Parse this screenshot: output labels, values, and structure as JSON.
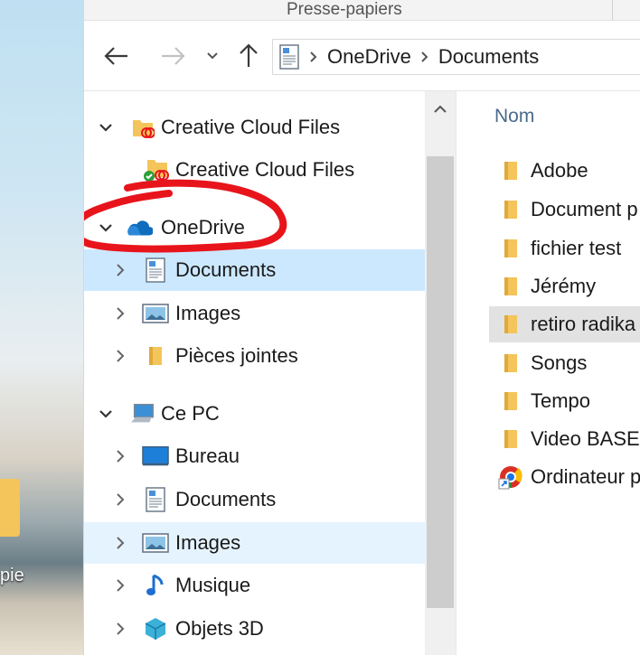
{
  "desktop": {
    "icon_label": "pie"
  },
  "ribbon": {
    "group_label": "Presse-papiers"
  },
  "address": {
    "back_icon": "arrow-left-icon",
    "forward_icon": "arrow-right-icon",
    "recent_icon": "chevron-down-icon",
    "up_icon": "arrow-up-icon",
    "crumbs": [
      "OneDrive",
      "Documents"
    ]
  },
  "nav": {
    "items": [
      {
        "label": "Creative Cloud Files",
        "icon": "cc-folder-icon",
        "expander": "chevron-down",
        "state": ""
      },
      {
        "label": "Creative Cloud Files",
        "icon": "cc-synced-folder-icon",
        "expander": "none",
        "state": ""
      },
      {
        "label": "OneDrive",
        "icon": "onedrive-cloud-icon",
        "expander": "chevron-down",
        "state": ""
      },
      {
        "label": "Documents",
        "icon": "documents-icon",
        "expander": "chevron-right",
        "state": "selected"
      },
      {
        "label": "Images",
        "icon": "images-icon",
        "expander": "chevron-right",
        "state": ""
      },
      {
        "label": "Pièces jointes",
        "icon": "folder-icon",
        "expander": "chevron-right",
        "state": ""
      },
      {
        "label": "Ce PC",
        "icon": "computer-icon",
        "expander": "chevron-down",
        "state": ""
      },
      {
        "label": "Bureau",
        "icon": "desktop-icon",
        "expander": "chevron-right",
        "state": ""
      },
      {
        "label": "Documents",
        "icon": "documents-icon",
        "expander": "chevron-right",
        "state": ""
      },
      {
        "label": "Images",
        "icon": "images-icon",
        "expander": "chevron-right",
        "state": "hover"
      },
      {
        "label": "Musique",
        "icon": "music-icon",
        "expander": "chevron-right",
        "state": ""
      },
      {
        "label": "Objets 3D",
        "icon": "objects-3d-icon",
        "expander": "chevron-right",
        "state": ""
      }
    ]
  },
  "files": {
    "column_name": "Nom",
    "items": [
      {
        "label": "Adobe",
        "icon": "folder-icon",
        "state": ""
      },
      {
        "label": "Document p",
        "icon": "folder-icon",
        "state": ""
      },
      {
        "label": "fichier test",
        "icon": "folder-icon",
        "state": ""
      },
      {
        "label": "Jérémy",
        "icon": "folder-icon",
        "state": ""
      },
      {
        "label": "retiro radika",
        "icon": "folder-icon",
        "state": "hover"
      },
      {
        "label": "Songs",
        "icon": "folder-icon",
        "state": ""
      },
      {
        "label": "Tempo",
        "icon": "folder-icon",
        "state": ""
      },
      {
        "label": "Video BASE",
        "icon": "folder-icon",
        "state": ""
      },
      {
        "label": "Ordinateur p",
        "icon": "chrome-shortcut-icon",
        "state": ""
      }
    ]
  },
  "colors": {
    "selected_bg": "#cce8ff",
    "hover_bg": "#e5f3ff",
    "folder_yellow": "#f4c55a",
    "onedrive_blue": "#0f6cbd",
    "annotation_red": "#e8141c"
  }
}
